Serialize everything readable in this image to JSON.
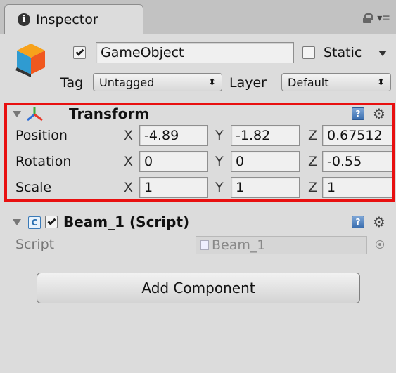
{
  "window": {
    "tab_label": "Inspector"
  },
  "game_object": {
    "name": "GameObject",
    "active": true,
    "static_label": "Static",
    "static": false,
    "tag_label": "Tag",
    "tag_value": "Untagged",
    "layer_label": "Layer",
    "layer_value": "Default"
  },
  "transform": {
    "title": "Transform",
    "rows": [
      {
        "label": "Position",
        "x": "-4.89",
        "y": "-1.82",
        "z": "0.67512"
      },
      {
        "label": "Rotation",
        "x": "0",
        "y": "0",
        "z": "-0.55"
      },
      {
        "label": "Scale",
        "x": "1",
        "y": "1",
        "z": "1"
      }
    ],
    "axis_x": "X",
    "axis_y": "Y",
    "axis_z": "Z"
  },
  "script_component": {
    "title": "Beam_1 (Script)",
    "enabled": true,
    "field_label": "Script",
    "field_value": "Beam_1"
  },
  "add_component_label": "Add Component",
  "colors": {
    "panel_bg": "#dcdcdc",
    "highlight_border": "#e81010",
    "help_icon": "#3b6fb0"
  }
}
